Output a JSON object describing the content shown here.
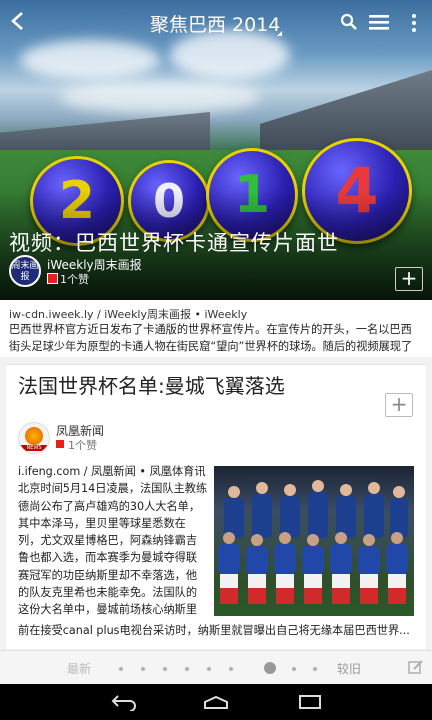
{
  "header": {
    "title": "聚焦巴西 2014",
    "icons": [
      "back-arrow-icon",
      "search-icon",
      "menu-icon",
      "overflow-icon"
    ]
  },
  "hero": {
    "balls": [
      "2",
      "0",
      "1",
      "4"
    ],
    "headline": "视频：巴西世界杯卡通宣传片面世",
    "publisher": "iWeekly周末画报",
    "publisher_logo": "周末画报",
    "likes": "1个赞"
  },
  "article1": {
    "source_line": "iw-cdn.iweek.ly / iWeekly周末画报 • iWeekly",
    "excerpt": "巴西世界杯官方近日发布了卡通版的世界杯宣传片。在宣传片的开头，一名以巴西街头足球少年为原型的卡通人物在街民窟“望向”世界杯的球场。随后的视频展现了浓郁的巴西风情——原始森林、街头足球文化、桑巴文化等。该视频的发布也..."
  },
  "article2": {
    "title": "法国世界杯名单:曼城飞翼落选",
    "publisher": "凤凰新闻",
    "publisher_logo": "NEWS",
    "likes": "1个赞",
    "source_prefix": "i.ifeng.com / 凤凰新闻 • 凤凰体育讯北京时间5月14日凌晨，法国队主教练德尚公布了高卢雄鸡的30人大名单，其中本泽马，里贝里等球星悉数在列，尤文双星博格巴，阿森纳锋霸吉鲁也都入选，而本赛季为曼城夺得联赛冠军的功臣纳斯里却不幸落选，他的队友克里希也未能幸免。法国队的这份大名单中，曼城前场核心纳斯里的落选无疑成为众人关注焦点。此",
    "body_end": "前在接受canal plus电视台采访时，纳斯里就冒曝出自己将无缘本届巴西世界..."
  },
  "pager": {
    "newest": "最新",
    "older": "较旧",
    "page_count": 9,
    "active_index": 6
  },
  "colors": {
    "flag_red": "#e8201a",
    "accent_purple": "#2a1fb0",
    "ball_rim": "#e9d000"
  }
}
